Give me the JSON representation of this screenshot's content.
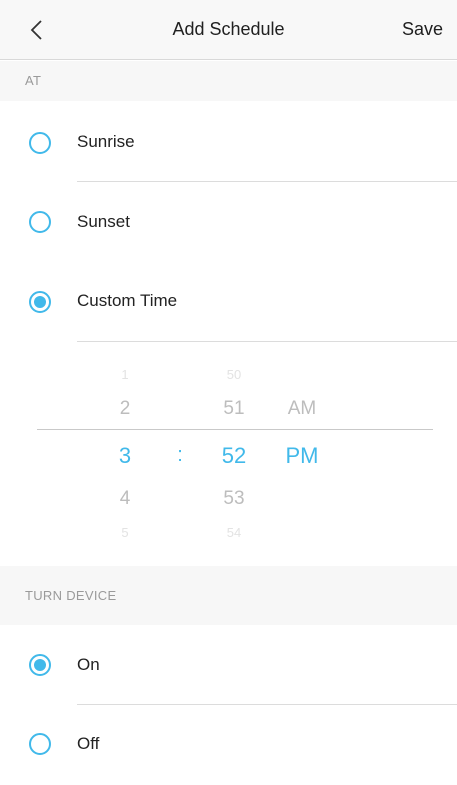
{
  "nav": {
    "back_icon": "chevron-left-icon",
    "title": "Add Schedule",
    "save_label": "Save"
  },
  "at_section": {
    "header": "AT",
    "options": [
      {
        "label": "Sunrise",
        "selected": false
      },
      {
        "label": "Sunset",
        "selected": false
      },
      {
        "label": "Custom Time",
        "selected": true
      }
    ]
  },
  "time_picker": {
    "hours": [
      "1",
      "2",
      "3",
      "4",
      "5"
    ],
    "separator": ":",
    "minutes": [
      "50",
      "51",
      "52",
      "53",
      "54"
    ],
    "meridiem": [
      "AM",
      "PM"
    ],
    "selected": {
      "hour": "3",
      "minute": "52",
      "meridiem": "PM"
    },
    "accent_color": "#41b9ea"
  },
  "turn_device_section": {
    "header": "TURN DEVICE",
    "options": [
      {
        "label": "On",
        "selected": true
      },
      {
        "label": "Off",
        "selected": false
      }
    ]
  },
  "colors": {
    "accent": "#41b9ea",
    "nav_bg": "#f8f8f8",
    "section_bg": "#f7f7f7"
  }
}
